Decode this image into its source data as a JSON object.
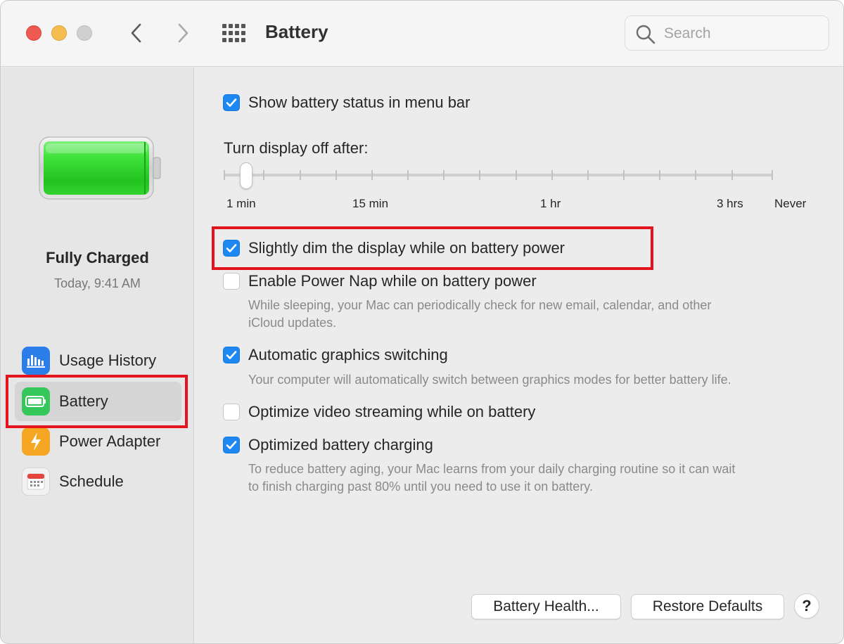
{
  "window": {
    "title": "Battery"
  },
  "search": {
    "placeholder": "Search"
  },
  "sidebar": {
    "status": "Fully Charged",
    "time": "Today, 9:41 AM",
    "items": [
      {
        "label": "Usage History",
        "icon": "bar-chart-icon",
        "color": "#2b7de9"
      },
      {
        "label": "Battery",
        "icon": "battery-icon",
        "color": "#34c759",
        "selected": true
      },
      {
        "label": "Power Adapter",
        "icon": "lightning-bolt-icon",
        "color": "#f5a623"
      },
      {
        "label": "Schedule",
        "icon": "calendar-icon",
        "color": "#e5443a"
      }
    ]
  },
  "options": {
    "menu_bar": {
      "label": "Show battery status in menu bar",
      "checked": true
    },
    "dim_display": {
      "label": "Slightly dim the display while on battery power",
      "checked": true
    },
    "power_nap": {
      "label": "Enable Power Nap while on battery power",
      "checked": false,
      "desc1": "While sleeping, your Mac can periodically check for new email, calendar, and other",
      "desc2": "iCloud updates."
    },
    "graphics_switching": {
      "label": "Automatic graphics switching",
      "checked": true,
      "desc": "Your computer will automatically switch between graphics modes for better battery life."
    },
    "video_streaming": {
      "label": "Optimize video streaming while on battery",
      "checked": false
    },
    "battery_charging": {
      "label": "Optimized battery charging",
      "checked": true,
      "desc1": "To reduce battery aging, your Mac learns from your daily charging routine so it can wait",
      "desc2": "to finish charging past 80% until you need to use it on battery."
    }
  },
  "display_slider": {
    "title": "Turn display off after:",
    "labels": {
      "l1": "1 min",
      "l2": "15 min",
      "l3": "1 hr",
      "l4": "3 hrs",
      "l5": "Never"
    },
    "selected": "1 min"
  },
  "buttons": {
    "battery_health": "Battery Health...",
    "restore_defaults": "Restore Defaults",
    "help": "?"
  },
  "colors": {
    "accent": "#1e88f2",
    "highlight": "#e3141e",
    "battery_green": "#3ed43a"
  }
}
